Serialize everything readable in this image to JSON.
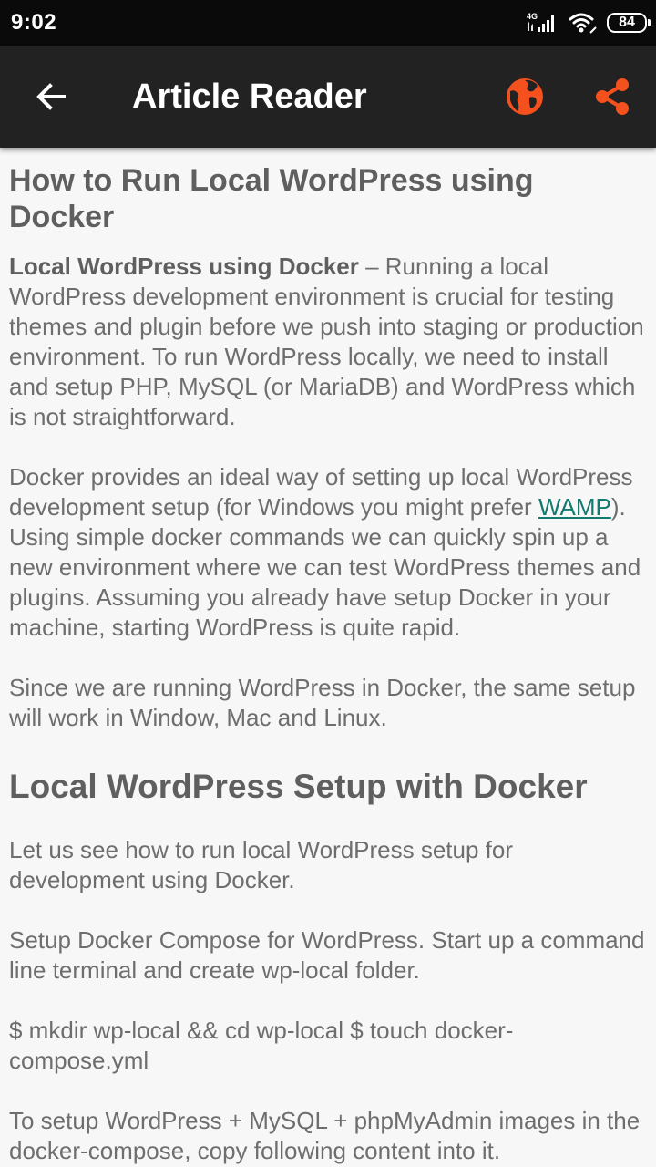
{
  "status_bar": {
    "time": "9:02",
    "network": "4G",
    "battery": "84"
  },
  "app_bar": {
    "title": "Article Reader",
    "back_icon": "arrow-left-icon",
    "open_in_browser_icon": "globe-icon",
    "share_icon": "share-icon",
    "accent_color": "#f4511e"
  },
  "article": {
    "title": "How to Run Local WordPress using Docker",
    "intro_bold": "Local WordPress using Docker",
    "intro_rest": " – Running a local WordPress development environment is crucial for testing themes and plugin before we push into staging or production environment. To run WordPress locally, we need to install and setup PHP, MySQL (or MariaDB) and WordPress which is not straightforward.",
    "p2_before_link": "Docker provides an ideal way of setting up local WordPress development setup (for Windows you might prefer ",
    "p2_link": "WAMP",
    "p2_after_link": "). Using simple docker commands we can quickly spin up a new environment where we can test WordPress themes and plugins. Assuming you already have setup Docker in your machine, starting WordPress is quite rapid.",
    "p3": "Since we are running WordPress in Docker, the same setup will work in Window, Mac and Linux.",
    "section_heading": "Local WordPress Setup with Docker",
    "p4": "Let us see how to run local WordPress setup for development using Docker.",
    "p5": "Setup Docker Compose for WordPress. Start up a command line terminal and create wp-local folder.",
    "p6": "$ mkdir wp-local && cd wp-local $ touch docker-compose.yml",
    "p7": "To setup WordPress + MySQL + phpMyAdmin images in the docker-compose, copy following content into it."
  }
}
